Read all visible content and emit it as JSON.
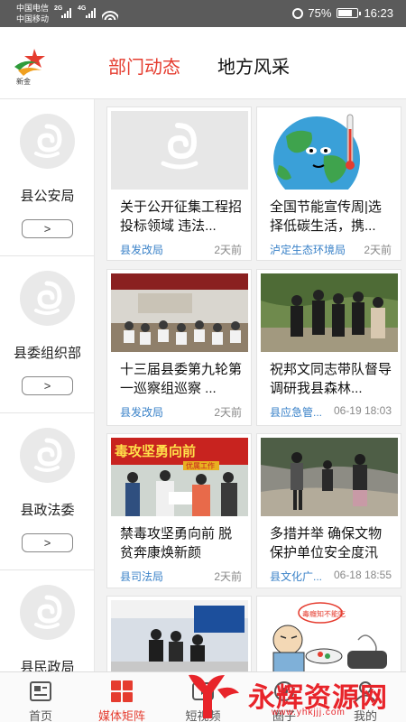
{
  "status_bar": {
    "carrier1": "中国电信",
    "carrier2": "中国移动",
    "net1": "2G",
    "net2": "4G",
    "battery": "75%",
    "time": "16:23"
  },
  "header": {
    "logo_text": "新金",
    "tabs": [
      {
        "label": "部门动态",
        "active": true
      },
      {
        "label": "地方风采",
        "active": false
      }
    ]
  },
  "departments": [
    {
      "name": "县公安局",
      "arrow": ">"
    },
    {
      "name": "县委组织部",
      "arrow": ">"
    },
    {
      "name": "县政法委",
      "arrow": ">"
    },
    {
      "name": "县民政局",
      "arrow": ">"
    }
  ],
  "articles": [
    {
      "title": "关于公开征集工程招投标领域 违法...",
      "source": "县发改局",
      "time": "2天前",
      "thumb": "placeholder"
    },
    {
      "title": "全国节能宣传周|选择低碳生活，携...",
      "source": "泸定生态环境局",
      "time": "2天前",
      "thumb": "hot-earth"
    },
    {
      "title": "十三届县委第九轮第一巡察组巡察 ...",
      "source": "县发改局",
      "time": "2天前",
      "thumb": "meeting-photo"
    },
    {
      "title": "祝邦文同志带队督导调研我县森林...",
      "source": "县应急管...",
      "time": "06-19 18:03",
      "thumb": "outdoor-group-photo"
    },
    {
      "title": "禁毒攻坚勇向前 脱贫奔康焕新颜",
      "source": "县司法局",
      "time": "2天前",
      "thumb": "antidrug-photo"
    },
    {
      "title": "多措并举 确保文物保护单位安全度汛",
      "source": "县文化广...",
      "time": "06-18 18:55",
      "thumb": "riverbank-photo"
    },
    {
      "title": "",
      "source": "",
      "time": "",
      "thumb": "indoor-photo"
    },
    {
      "title": "",
      "source": "",
      "time": "",
      "thumb": "cartoon"
    }
  ],
  "thumb_texts": {
    "antidrug_banner": "毒攻坚勇向前",
    "antidrug_sub": "优属工作",
    "cartoon_bubble": "毒癮知不能吃"
  },
  "bottom_nav": [
    {
      "label": "首页",
      "icon": "home-icon",
      "active": false
    },
    {
      "label": "媒体矩阵",
      "icon": "grid-icon",
      "active": true
    },
    {
      "label": "短视频",
      "icon": "video-icon",
      "active": false
    },
    {
      "label": "圈子",
      "icon": "circle-icon",
      "active": false
    },
    {
      "label": "我的",
      "icon": "user-icon",
      "active": false
    }
  ],
  "watermark": {
    "text": "永辉资源网",
    "url": "www.yhkjjj.com"
  },
  "colors": {
    "accent": "#e53c2f",
    "source_blue": "#3a82c8",
    "statusbar": "#5b5b5b"
  }
}
